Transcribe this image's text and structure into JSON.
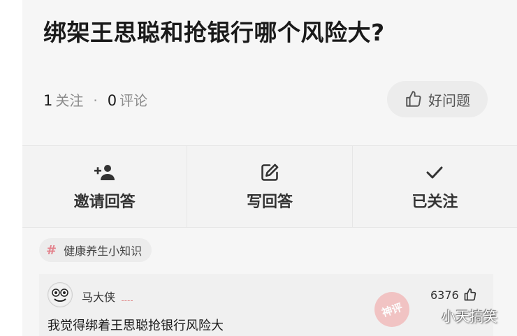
{
  "question": {
    "title": "绑架王思聪和抢银行哪个风险大?",
    "follow_count": "1",
    "follow_label": "关注",
    "comment_count": "0",
    "comment_label": "评论",
    "separator": "·",
    "good_question_label": "好问题"
  },
  "actions": {
    "invite_label": "邀请回答",
    "write_label": "写回答",
    "followed_label": "已关注"
  },
  "topic": {
    "hash": "#",
    "label": "健康养生小知识"
  },
  "answer": {
    "author": "马大侠",
    "likes": "6376",
    "text": "我觉得绑着王思聪抢银行风险大"
  },
  "overlay": {
    "stamp_text": "神评",
    "watermark": "小天搞笑"
  },
  "colors": {
    "accent_tag": "#e3828c",
    "stamp": "#f2bcbc",
    "background": "#f6f6f6"
  },
  "icons": {
    "good_question": "thumbs-up-icon",
    "invite": "add-person-icon",
    "write": "edit-icon",
    "followed": "checkmark-icon",
    "likes": "thumbs-up-icon"
  }
}
